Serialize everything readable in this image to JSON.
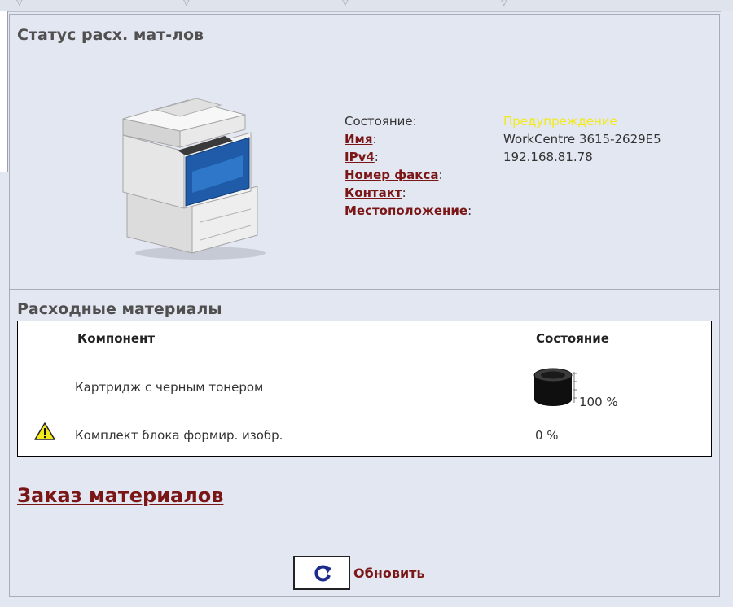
{
  "status_section": {
    "title": "Статус расх. мат-лов"
  },
  "device_info": {
    "state_label": "Состояние:",
    "state_value": "Предупреждение",
    "name_label": "Имя",
    "name_value": "WorkCentre 3615-2629E5",
    "ipv4_label": "IPv4",
    "ipv4_value": "192.168.81.78",
    "fax_label": "Номер факса",
    "contact_label": "Контакт",
    "location_label": "Местоположение",
    "colon": ":"
  },
  "consumables": {
    "title": "Расходные материалы",
    "col_component": "Компонент",
    "col_status": "Состояние",
    "rows": [
      {
        "name": "Картридж с черным тонером",
        "value": "100 %",
        "level": 1.0,
        "icon": "toner-cartridge-icon"
      },
      {
        "name": "Комплект блока формир. изобр.",
        "value": "0 %",
        "level": 0.0,
        "icon": "warning-icon"
      }
    ]
  },
  "order_link": "Заказ материалов",
  "refresh_link": "Обновить",
  "colors": {
    "link": "#7a1616",
    "warning": "#f2ea1a",
    "background": "#e3e7f1"
  }
}
